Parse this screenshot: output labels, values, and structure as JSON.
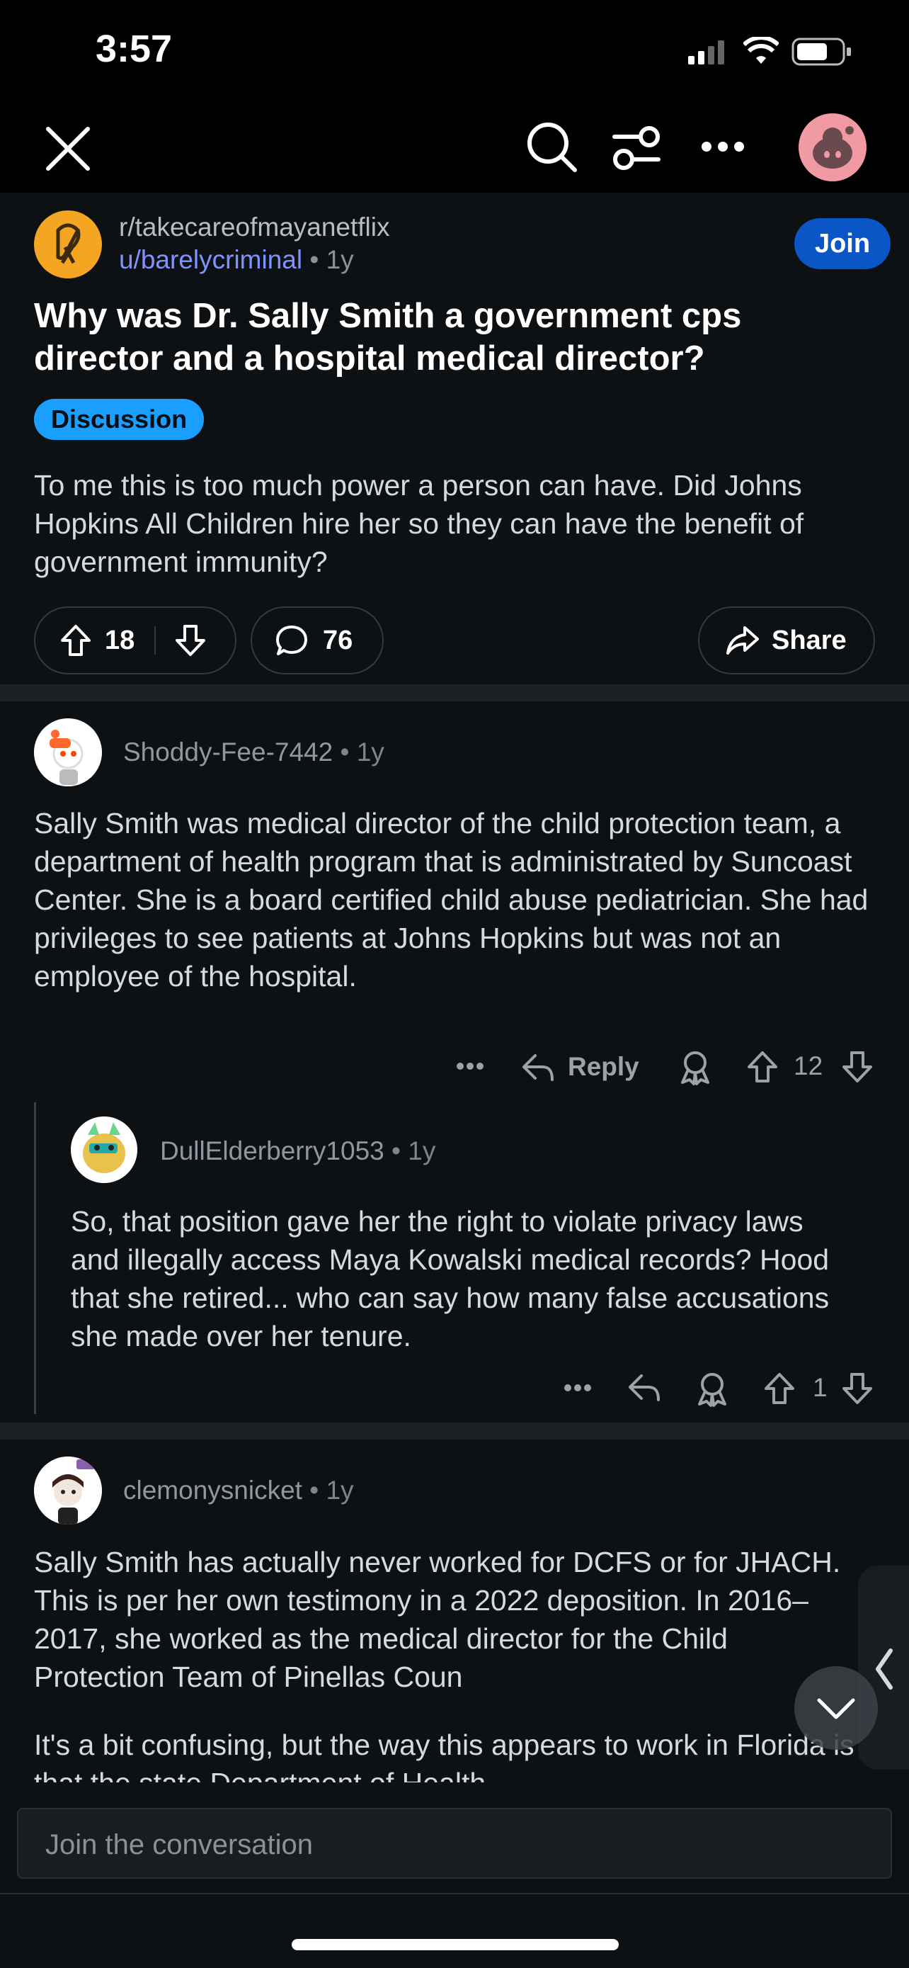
{
  "status": {
    "time": "3:57"
  },
  "post": {
    "subreddit": "r/takecareofmayanetflix",
    "author": "u/barelycriminal",
    "age": "1y",
    "join_label": "Join",
    "title": "Why was Dr. Sally Smith a government cps director and a hospital medical director?",
    "flair": "Discussion",
    "body": "To me this is too much power a person can have. Did Johns Hopkins All Children hire her so they can have the benefit of government immunity?",
    "votes": "18",
    "comments": "76",
    "share_label": "Share"
  },
  "comments": [
    {
      "user": "Shoddy-Fee-7442",
      "age": "1y",
      "text": "Sally Smith was medical director of the child protection team, a department of health program that is administrated by Suncoast Center. She is a board certified child abuse pediatrician. She had privileges to see patients at Johns Hopkins but was not an employee of the hospital.",
      "reply_label": "Reply",
      "votes": "12"
    },
    {
      "user": "DullElderberry1053",
      "age": "1y",
      "text": "So, that position gave her the right to violate privacy laws and illegally access Maya Kowalski medical records?  Hood that she retired... who can say how many false accusations she made over her tenure.",
      "votes": "1"
    },
    {
      "user": "clemonysnicket",
      "age": "1y",
      "text": "Sally Smith has actually never worked for DCFS or for JHACH. This is per her own testimony in a 2022 deposition. In 2016–2017, she worked as the medical director for the Child Protection Team of Pinellas Coun",
      "text2": "It's a bit confusing, but the way this appears to work in Florida is that the state Department of Health"
    }
  ],
  "composer": {
    "placeholder": "Join the conversation"
  },
  "icons": [
    "close-icon",
    "search-icon",
    "filter-icon",
    "more-icon",
    "profile-avatar",
    "upvote-icon",
    "downvote-icon",
    "comment-icon",
    "share-icon",
    "reply-icon",
    "award-icon",
    "chevron-down-icon",
    "chevron-left-icon"
  ],
  "colors": {
    "join": "#0a56c7",
    "flair": "#1a9fff",
    "link": "#7f93ff",
    "background": "#0e1113"
  }
}
